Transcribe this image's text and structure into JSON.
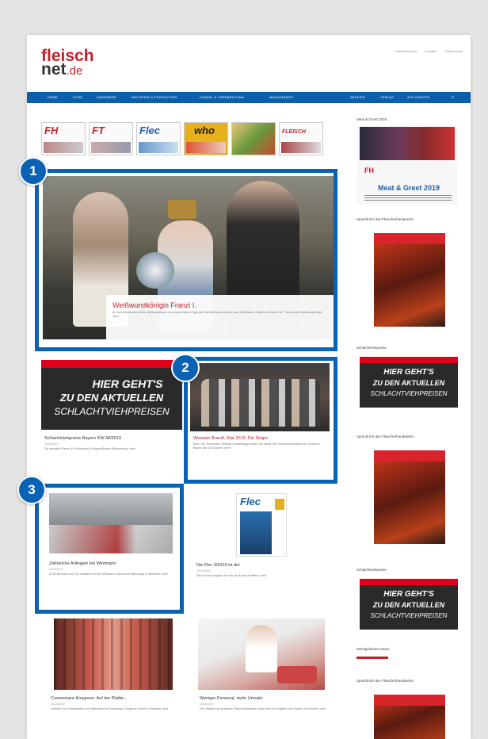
{
  "site": {
    "logo_line1": "fleisch",
    "logo_line2": "net",
    "logo_tld": ".de",
    "top_links": [
      "Über fleischnet",
      "Kontakt",
      "Datenschutz"
    ]
  },
  "nav": {
    "items": [
      "HOME",
      "FOOD",
      "HANDWERK",
      "INDUSTRIE & PRODUKTION",
      "HANDEL & VERMARKTUNG",
      "MANAGEMENT"
    ],
    "right_items": [
      "SERVICE",
      "VERLAG",
      "AHT-GROUPS"
    ]
  },
  "magazines": [
    "FH",
    "FT",
    "Flec",
    "who",
    "",
    "FLEISCH"
  ],
  "featured": {
    "title": "Weißwurstkönigin Franzi I.",
    "text": "Bei den Münchnern soll die Weißwurstkrone. Zum ersten Mal in Folge geht die Weißwurst Krönen nach Weinmann's Franzi zur Rolle in ihr 7. Besuch ein Weißwurstkönigin mehr"
  },
  "cards": [
    {
      "banner_line1": "HIER GEHT'S",
      "banner_line2": "ZU DEN AKTUELLEN",
      "banner_line3": "SCHLACHTVIEHPREISEN",
      "title": "Schlachtviehpreise Bayern KW 40/2019",
      "date": "10/10/2019",
      "text": "Die aktuellen Preise für Schlachtvieh in Bayern/Baden-Württemberg. mehr"
    },
    {
      "title": "Weinalm Brandl, Star 2019: Die Sieger",
      "text": "Beim 100. Deutschen Fleischer-Verbandstag wurden die Sieger des Fleischerhandwerks der Gewinner Brandl Star 2019 geehrt. mehr"
    },
    {
      "title": "Zahlreiche Anfragen bei Wintmann",
      "date": "10/10/2019",
      "text": "8.000 Besucher und 211 Aussteller bei der Wintmann-Fachmesse Werkzeuge in Weinheim. mehr"
    },
    {
      "title": "Die Flec 9/2019 ist da!",
      "date": "10/10/2019",
      "text": "Die neueste Ausgabe der Flec ist ab jetzt erhältlich. mehr"
    },
    {
      "title": "Cosmomare Kongress: Auf der Plattie...",
      "date": "10/10/2019",
      "text": "Vertreter von Fachschaften und Lieferanten im Cosmomare Congress Center in Hamburg. mehr"
    },
    {
      "title": "Weniger Personal, mehr Umsatz",
      "date": "10/10/2019",
      "text": "Die Umsätze im deutschen Fleischerhandwerk haben sich im Vergleich zum Vorjahr 2019 erhöht. mehr"
    }
  ],
  "sidebar": {
    "meat_greet_title": "Meat & Greet 2019",
    "meat_greet_banner_headline": "Meat & Greet 2019",
    "sprachrohr1": "Sprachrohr des Fleischerhandwerks",
    "schlacht1": "Schlachtviehpreise",
    "sprachrohr2": "Sprachrohr des Fleischerhandwerks",
    "schlacht2": "Schlachtviehpreise",
    "news_title": "Meistgelesene News",
    "sprachrohr3": "Sprachrohr des Fleischerhandwerks",
    "banner_line1": "HIER GEHT'S",
    "banner_line2": "ZU DEN AKTUELLEN",
    "banner_line3": "SCHLACHTVIEHPREISEN"
  },
  "badges": [
    "1",
    "2",
    "3"
  ],
  "colors": {
    "brand_red": "#c3202b",
    "nav_blue": "#0b5ea9",
    "highlight_blue": "#0a62b5"
  }
}
